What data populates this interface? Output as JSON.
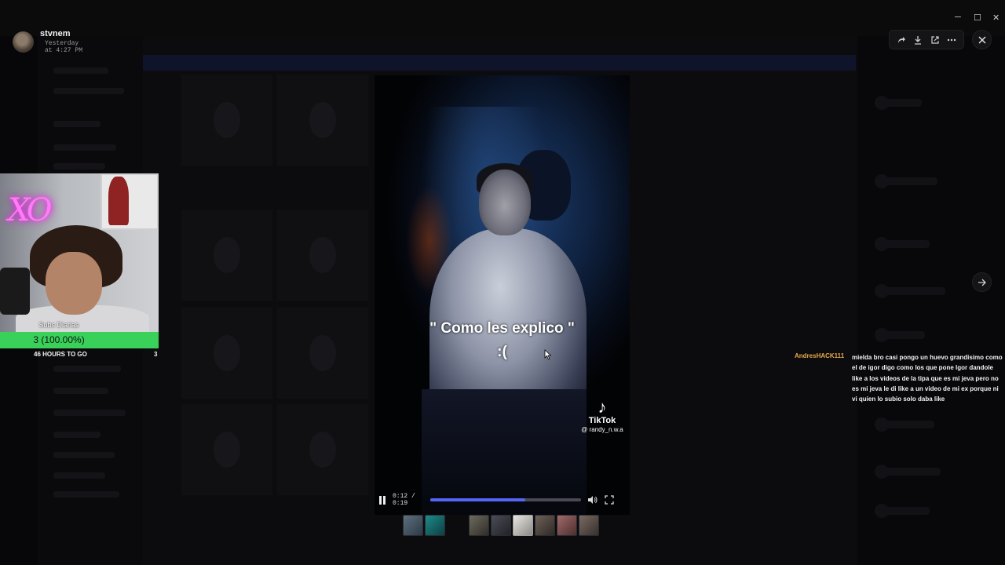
{
  "uploader": {
    "name": "stvnem",
    "timestamp": "Yesterday at 4:27 PM"
  },
  "toolbar": {
    "icons": [
      "forward-icon",
      "download-icon",
      "open-external-icon",
      "more-icon"
    ]
  },
  "video": {
    "caption_line1": "\" Como les explico \"",
    "caption_line2": ":(",
    "watermark_brand": "TikTok",
    "watermark_user": "@ randy_n.w.a",
    "time_display": "0:12 / 0:19",
    "progress_fraction": 0.63
  },
  "stream_overlay": {
    "label": "Subs Diarias",
    "bar_text": "3 (100.00%)",
    "bar_fraction": 1.0,
    "footer_left": "46 HOURS TO GO",
    "footer_right": "3",
    "neon_sign": "XO"
  },
  "chat": {
    "username": "AndresHACK111",
    "message": "mielda bro casi pongo un huevo grandisimo como el de igor digo como los que pone Igor dandole like a los videos de la tipa que es mi jeva pero no es mi jeva le di like a un video de mi ex porque ni vi quien lo subio solo daba like"
  },
  "colors": {
    "accent": "#5865f2",
    "subs_bar": "#39d15a",
    "chat_user": "#e7a84c"
  }
}
